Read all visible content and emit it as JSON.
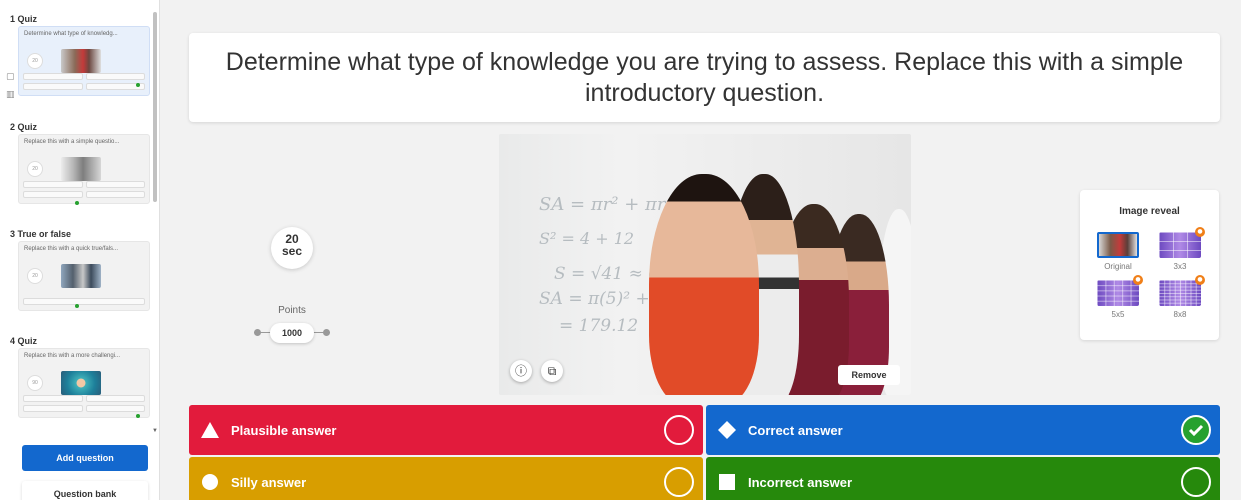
{
  "sidebar": {
    "tools": [
      "chat-icon",
      "trash-icon"
    ],
    "questions": [
      {
        "head": "1 Quiz",
        "title": "Determine what type of knowledg...",
        "timer": "20",
        "thumb": "students-photo"
      },
      {
        "head": "2 Quiz",
        "title": "Replace this with a simple questio...",
        "timer": "20",
        "thumb": "classroom-photo"
      },
      {
        "head": "3 True or false",
        "title": "Replace this with a quick true/fals...",
        "timer": "20",
        "thumb": "group-photo"
      },
      {
        "head": "4 Quiz",
        "title": "Replace this with a more challengi...",
        "timer": "90",
        "thumb": "celebration-photo"
      }
    ],
    "add_question_label": "Add question",
    "question_bank_label": "Question bank"
  },
  "question": {
    "text": "Determine what type of knowledge you are trying to assess. Replace this with a simple introductory question."
  },
  "timer": {
    "value": "20",
    "unit": "sec"
  },
  "points": {
    "label": "Points",
    "value": "1000"
  },
  "media": {
    "remove_label": "Remove",
    "info_icon": "info-icon",
    "crop_icon": "crop-icon"
  },
  "image_reveal": {
    "title": "Image reveal",
    "options": [
      {
        "label": "Original",
        "selected": true,
        "locked": false
      },
      {
        "label": "3x3",
        "selected": false,
        "locked": true
      },
      {
        "label": "5x5",
        "selected": false,
        "locked": true
      },
      {
        "label": "8x8",
        "selected": false,
        "locked": true
      }
    ]
  },
  "answers": [
    {
      "label": "Plausible answer",
      "shape": "triangle",
      "color": "#e21b3c",
      "correct": false
    },
    {
      "label": "Correct answer",
      "shape": "diamond",
      "color": "#1368ce",
      "correct": true
    },
    {
      "label": "Silly answer",
      "shape": "circle",
      "color": "#d89e00",
      "correct": false
    },
    {
      "label": "Incorrect answer",
      "shape": "square",
      "color": "#26890c",
      "correct": false
    }
  ]
}
